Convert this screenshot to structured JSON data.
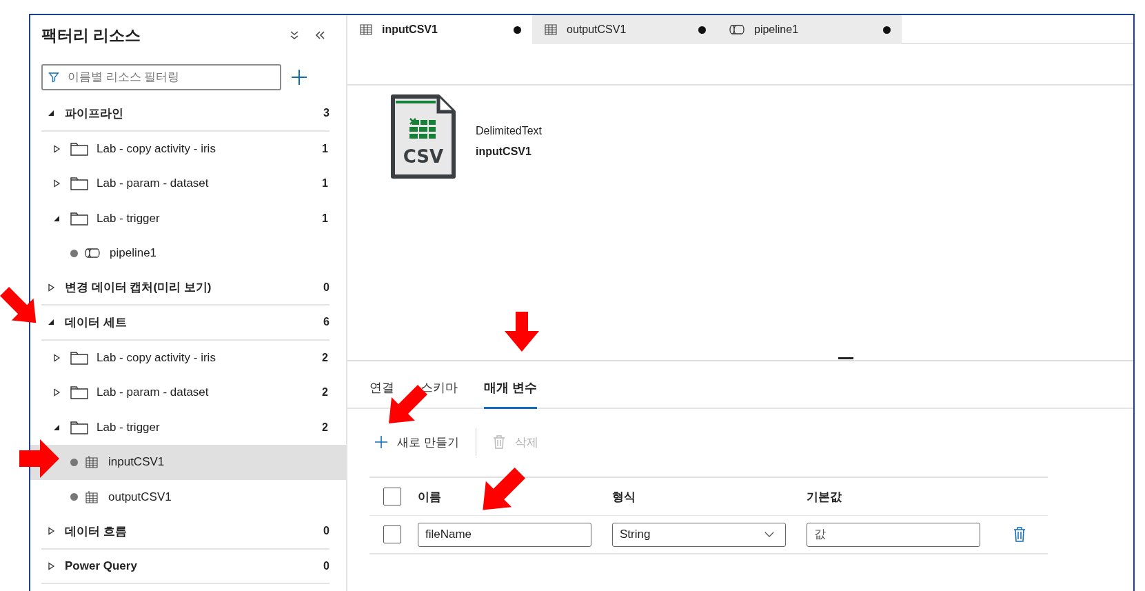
{
  "sidebar": {
    "title": "팩터리 리소스",
    "filter": {
      "placeholder": "이름별 리소스 필터링"
    },
    "sections": [
      {
        "label": "파이프라인",
        "count": "3",
        "expanded": true,
        "children": [
          {
            "label": "Lab - copy activity - iris",
            "count": "1",
            "expanded": false
          },
          {
            "label": "Lab - param - dataset",
            "count": "1",
            "expanded": false
          },
          {
            "label": "Lab - trigger",
            "count": "1",
            "expanded": true,
            "children": [
              {
                "label": "pipeline1",
                "kind": "pipeline",
                "selected": false
              }
            ]
          }
        ]
      },
      {
        "label": "변경 데이터 캡처(미리 보기)",
        "count": "0",
        "expanded": false
      },
      {
        "label": "데이터 세트",
        "count": "6",
        "expanded": true,
        "children": [
          {
            "label": "Lab - copy activity - iris",
            "count": "2",
            "expanded": false
          },
          {
            "label": "Lab - param - dataset",
            "count": "2",
            "expanded": false
          },
          {
            "label": "Lab - trigger",
            "count": "2",
            "expanded": true,
            "children": [
              {
                "label": "inputCSV1",
                "kind": "dataset",
                "selected": true
              },
              {
                "label": "outputCSV1",
                "kind": "dataset",
                "selected": false
              }
            ]
          }
        ]
      },
      {
        "label": "데이터 흐름",
        "count": "0",
        "expanded": false
      },
      {
        "label": "Power Query",
        "count": "0",
        "expanded": false
      }
    ]
  },
  "tabs": [
    {
      "label": "inputCSV1",
      "kind": "dataset",
      "selected": true,
      "unsaved": true
    },
    {
      "label": "outputCSV1",
      "kind": "dataset",
      "selected": false,
      "unsaved": true
    },
    {
      "label": "pipeline1",
      "kind": "pipeline",
      "selected": false,
      "unsaved": true
    }
  ],
  "dataset": {
    "icon_label": "CSV",
    "type": "DelimitedText",
    "name": "inputCSV1"
  },
  "detail_tabs": [
    {
      "label": "연결",
      "selected": false
    },
    {
      "label": "스키마",
      "selected": false
    },
    {
      "label": "매개 변수",
      "selected": true
    }
  ],
  "toolbar": {
    "new_label": "새로 만들기",
    "delete_label": "삭제",
    "delete_disabled": true
  },
  "parameters": {
    "select_all_checked": false,
    "columns": [
      "이름",
      "형식",
      "기본값"
    ],
    "rows": [
      {
        "checked": false,
        "name": "fileName",
        "type": "String",
        "default_placeholder": "값"
      }
    ]
  }
}
